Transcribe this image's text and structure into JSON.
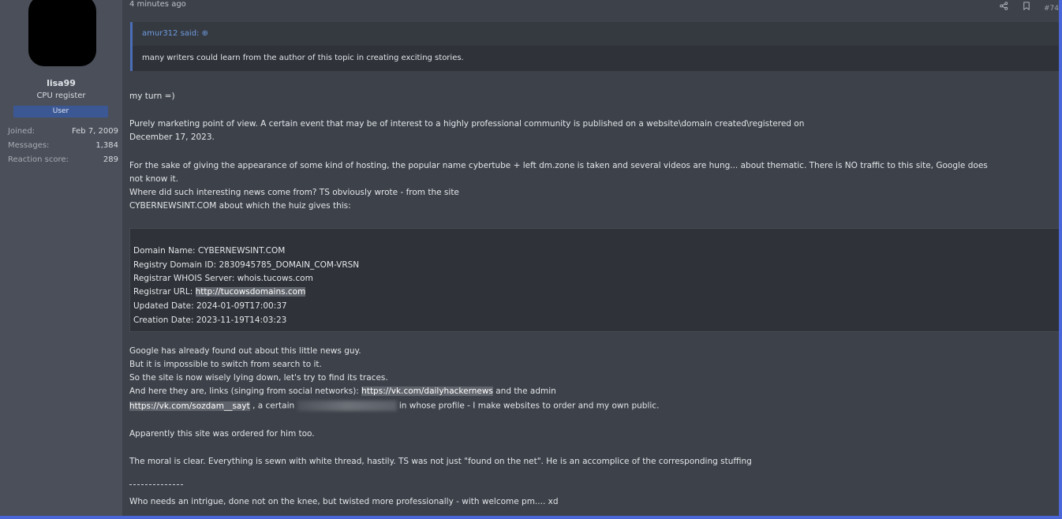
{
  "user": {
    "name": "lisa99",
    "title": "CPU register",
    "badge": "User",
    "stats": [
      {
        "key": "Joined:",
        "value": "Feb 7, 2009"
      },
      {
        "key": "Messages:",
        "value": "1,384"
      },
      {
        "key": "Reaction score:",
        "value": "289"
      }
    ]
  },
  "post": {
    "time": "4 minutes ago",
    "share_icon": "share-icon",
    "bookmark_icon": "bookmark-icon",
    "number": "#74",
    "quote": {
      "author_line": "amur312 said: ⊕",
      "text": "many writers could learn from the author of this topic in creating exciting stories."
    },
    "lines": {
      "l1": "my turn =)",
      "l2": "Purely marketing point of view. A certain event that may be of interest to a highly professional community is published on a website\\domain created\\registered on",
      "l3": "December 17, 2023.",
      "l4": "For the sake of giving the appearance of some kind of hosting, the popular name cybertube + left dm.zone is taken and several videos are hung... about thematic. There is NO traffic to this site, Google does",
      "l5": "not know it.",
      "l6": "Where did such interesting news come from? TS obviously wrote - from the site",
      "l7": "CYBERNEWSINT.COM about which the huiz gives this:",
      "whois1": "Domain Name: CYBERNEWSINT.COM",
      "whois2": "Registry Domain ID: 2830945785_DOMAIN_COM-VRSN",
      "whois3": "Registrar WHOIS Server: whois.tucows.com",
      "whois4_prefix": "Registrar URL: ",
      "whois4_link": "http://tucowsdomains.com",
      "whois5": "Updated Date: 2024-01-09T17:00:37",
      "whois6": "Creation Date: 2023-11-19T14:03:23",
      "g1": "Google has already found out about this little news guy.",
      "g2": "But it is impossible to switch from search to it.",
      "g3": "So the site is now wisely lying down, let's try to find its traces.",
      "g4_prefix": "And here they are, links (singing from social networks): ",
      "g4_link": "https://vk.com/dailyhackernews",
      "g4_suffix": " and the admin",
      "g5_link": "https://vk.com/sozdam__sayt",
      "g5_mid": " , a certain ",
      "g5_suffix": " in whose profile - I make websites to order and my own public.",
      "a1": "Apparently this site was ordered for him too.",
      "m1": "The moral is clear. Everything is sewn with white thread, hastily. TS was not just \"found on the net\". He is an accomplice of the corresponding stuffing",
      "w1": "Who needs an intrigue, done not on the knee, but twisted more professionally - with welcome pm.... xd"
    }
  }
}
